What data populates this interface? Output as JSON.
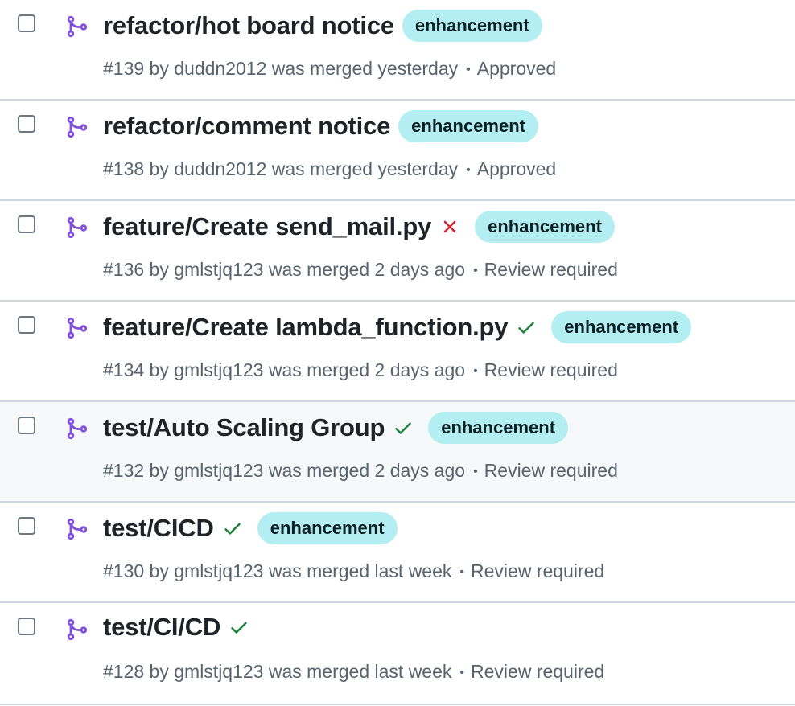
{
  "colors": {
    "merged_icon": "#8250df",
    "check_success": "#1a7f37",
    "check_failure": "#cf222e",
    "label_bg": "#b3eef2",
    "row_hover_bg": "#f6f8fa"
  },
  "pull_requests": [
    {
      "title": "refactor/hot board notice",
      "status": "none",
      "label": "enhancement",
      "meta": "#139 by duddn2012 was merged yesterday",
      "review": "Approved",
      "icon": "git-merge-icon"
    },
    {
      "title": "refactor/comment notice",
      "status": "none",
      "label": "enhancement",
      "meta": "#138 by duddn2012 was merged yesterday",
      "review": "Approved",
      "icon": "git-merge-icon"
    },
    {
      "title": "feature/Create send_mail.py",
      "status": "failure",
      "label": "enhancement",
      "meta": "#136 by gmlstjq123 was merged 2 days ago",
      "review": "Review required",
      "icon": "git-merge-icon"
    },
    {
      "title": "feature/Create lambda_function.py",
      "status": "success",
      "label": "enhancement",
      "meta": "#134 by gmlstjq123 was merged 2 days ago",
      "review": "Review required",
      "icon": "git-merge-icon"
    },
    {
      "title": "test/Auto Scaling Group",
      "status": "success",
      "label": "enhancement",
      "meta": "#132 by gmlstjq123 was merged 2 days ago",
      "review": "Review required",
      "icon": "git-merge-icon",
      "hovered": true
    },
    {
      "title": "test/CICD",
      "status": "success",
      "label": "enhancement",
      "meta": "#130 by gmlstjq123 was merged last week",
      "review": "Review required",
      "icon": "git-merge-icon"
    },
    {
      "title": "test/CI/CD",
      "status": "success",
      "label": "",
      "meta": "#128 by gmlstjq123 was merged last week",
      "review": "Review required",
      "icon": "git-merge-icon"
    }
  ]
}
